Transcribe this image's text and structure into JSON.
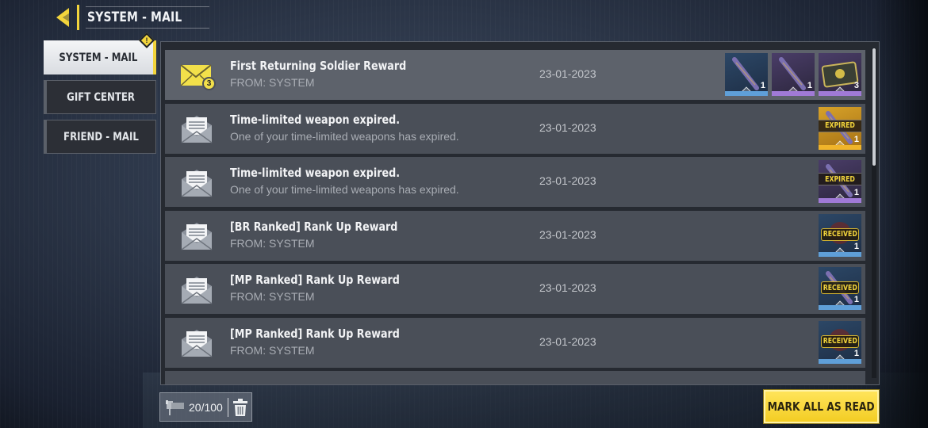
{
  "header": {
    "title": "SYSTEM - MAIL",
    "back_icon": "back-arrow-icon"
  },
  "sidebar": {
    "tabs": [
      {
        "label": "SYSTEM - MAIL",
        "active": true,
        "alert": true
      },
      {
        "label": "GIFT CENTER",
        "active": false
      },
      {
        "label": "FRIEND - MAIL",
        "active": false
      }
    ],
    "alert_glyph": "!"
  },
  "mails": [
    {
      "subject": "First Returning Soldier Reward",
      "sender": "FROM: SYSTEM",
      "date": "23-01-2023",
      "unread": true,
      "unread_count": "3",
      "icon": "envelope-closed-icon",
      "rewards": [
        {
          "type": "weapon-skin",
          "rarity": "blue",
          "qty": "1",
          "status": ""
        },
        {
          "type": "weapon-skin",
          "rarity": "purple",
          "qty": "1",
          "status": ""
        },
        {
          "type": "card",
          "rarity": "purple",
          "qty": "3",
          "status": ""
        }
      ]
    },
    {
      "subject": "Time-limited weapon expired.",
      "sender": "One of your time-limited weapons has expired.",
      "date": "23-01-2023",
      "unread": false,
      "icon": "envelope-open-icon",
      "rewards": [
        {
          "type": "weapon",
          "rarity": "gold",
          "qty": "1",
          "status": "EXPIRED"
        }
      ]
    },
    {
      "subject": "Time-limited weapon expired.",
      "sender": "One of your time-limited weapons has expired.",
      "date": "23-01-2023",
      "unread": false,
      "icon": "envelope-open-icon",
      "rewards": [
        {
          "type": "weapon",
          "rarity": "purple",
          "qty": "1",
          "status": "EXPIRED"
        }
      ]
    },
    {
      "subject": "[BR Ranked] Rank Up Reward",
      "sender": "FROM: SYSTEM",
      "date": "23-01-2023",
      "unread": false,
      "icon": "envelope-open-icon",
      "rewards": [
        {
          "type": "emblem",
          "rarity": "blue",
          "qty": "1",
          "status": "RECEIVED"
        }
      ]
    },
    {
      "subject": "[MP Ranked] Rank Up Reward",
      "sender": "FROM: SYSTEM",
      "date": "23-01-2023",
      "unread": false,
      "icon": "envelope-open-icon",
      "rewards": [
        {
          "type": "weapon-sticker",
          "rarity": "blue",
          "qty": "1",
          "status": "RECEIVED"
        }
      ]
    },
    {
      "subject": "[MP Ranked] Rank Up Reward",
      "sender": "FROM: SYSTEM",
      "date": "23-01-2023",
      "unread": false,
      "icon": "envelope-open-icon",
      "rewards": [
        {
          "type": "emblem",
          "rarity": "blue",
          "qty": "1",
          "status": "RECEIVED"
        }
      ]
    }
  ],
  "footer": {
    "mailbox_count": "20/100",
    "mailbox_icon": "mailbox-icon",
    "delete_icon": "trash-icon",
    "mark_all_label": "MARK ALL AS READ"
  },
  "colors": {
    "accent_yellow": "#f2d43c",
    "rarity_blue": "#5f9fd8",
    "rarity_purple": "#a07ad6",
    "rarity_gold": "#f0b42a"
  }
}
